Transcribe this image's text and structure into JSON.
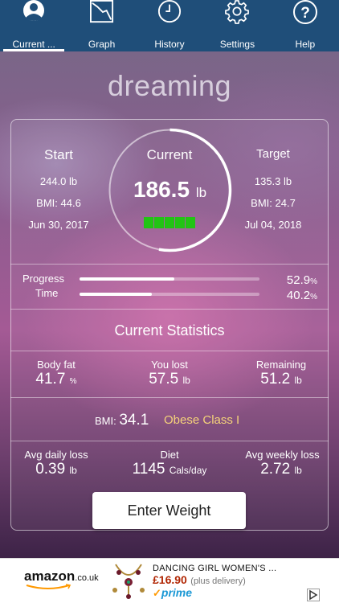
{
  "nav": {
    "tabs": [
      {
        "label": "Current ...",
        "icon": "profile-icon",
        "active": true
      },
      {
        "label": "Graph",
        "icon": "graph-icon",
        "active": false
      },
      {
        "label": "History",
        "icon": "clock-icon",
        "active": false
      },
      {
        "label": "Settings",
        "icon": "gear-icon",
        "active": false
      },
      {
        "label": "Help",
        "icon": "help-icon",
        "active": false
      }
    ]
  },
  "profile_name": "dreaming",
  "start": {
    "label": "Start",
    "weight": "244.0 lb",
    "bmi": "BMI: 44.6",
    "date": "Jun 30, 2017"
  },
  "current": {
    "label": "Current",
    "weight": "186.5",
    "unit": "lb",
    "progress_fraction": 0.529
  },
  "target": {
    "label": "Target",
    "weight": "135.3 lb",
    "bmi": "BMI: 24.7",
    "date": "Jul 04, 2018"
  },
  "progress": {
    "progress_label": "Progress",
    "progress_value": "52.9",
    "progress_unit": "%",
    "time_label": "Time",
    "time_value": "40.2",
    "time_unit": "%",
    "progress_fraction": 0.529,
    "time_fraction": 0.402
  },
  "statistics": {
    "heading": "Current Statistics",
    "body_fat": {
      "label": "Body fat",
      "value": "41.7",
      "unit": "%"
    },
    "you_lost": {
      "label": "You lost",
      "value": "57.5",
      "unit": "lb"
    },
    "remaining": {
      "label": "Remaining",
      "value": "51.2",
      "unit": "lb"
    },
    "bmi": {
      "label": "BMI:",
      "value": "34.1",
      "class": "Obese Class I"
    },
    "avg_daily_loss": {
      "label": "Avg daily loss",
      "value": "0.39",
      "unit": "lb"
    },
    "diet": {
      "label": "Diet",
      "value": "1145",
      "unit": "Cals/day"
    },
    "avg_weekly_loss": {
      "label": "Avg weekly loss",
      "value": "2.72",
      "unit": "lb"
    }
  },
  "enter_weight_label": "Enter Weight",
  "ad": {
    "brand": "amazon",
    "brand_suffix": ".co.uk",
    "title": "DANCING GIRL WOMEN'S ...",
    "price": "£16.90",
    "delivery": "(plus delivery)",
    "prime": "prime"
  },
  "colors": {
    "nav": "#1f4e79",
    "accent": "#ffe000",
    "progress_green": "#22c414"
  }
}
